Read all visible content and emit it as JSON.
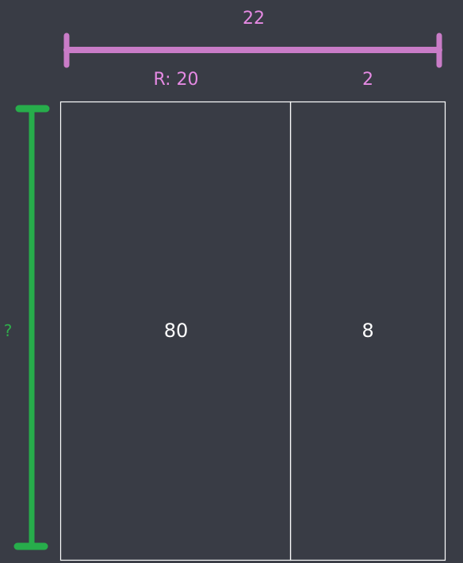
{
  "colors": {
    "background": "#393c45",
    "pink": "#c97cc7",
    "pink_text": "#e58ae3",
    "green": "#27ad4b",
    "green_text": "#2fae4a",
    "white": "#ffffff"
  },
  "top_dimension": {
    "total_label": "22"
  },
  "columns": [
    {
      "header": "R: 20",
      "value": "80"
    },
    {
      "header": "2",
      "value": "8"
    }
  ],
  "side_dimension": {
    "label": "?"
  }
}
